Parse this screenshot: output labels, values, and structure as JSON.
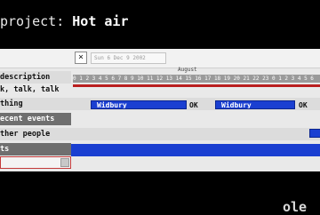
{
  "header": {
    "prefix": "project:",
    "project_name": "Hot air"
  },
  "toolbar": {
    "close_glyph": "×",
    "date_value": "Sun 6 Dec 9 2002"
  },
  "timeline": {
    "month_label": "August",
    "hours": "0 1 2 3 4 5 6 7 8 9 10 11 12 13 14 15 16 17 18 19 20 21 22 23 0 1 2 3 4 5 6"
  },
  "rows": [
    {
      "label": "description"
    },
    {
      "label": "k, talk, talk"
    },
    {
      "label": "thing"
    },
    {
      "label": "ecent events"
    },
    {
      "label": "ther people"
    },
    {
      "label": "ts"
    }
  ],
  "bars": [
    {
      "label": "Widbury",
      "status": "OK"
    },
    {
      "label": "Widbury",
      "status": "OK"
    }
  ],
  "colors": {
    "bar": "#1a3fd1",
    "accent_line": "#b91e1e",
    "background": "#000000"
  },
  "corner_text": "ole"
}
